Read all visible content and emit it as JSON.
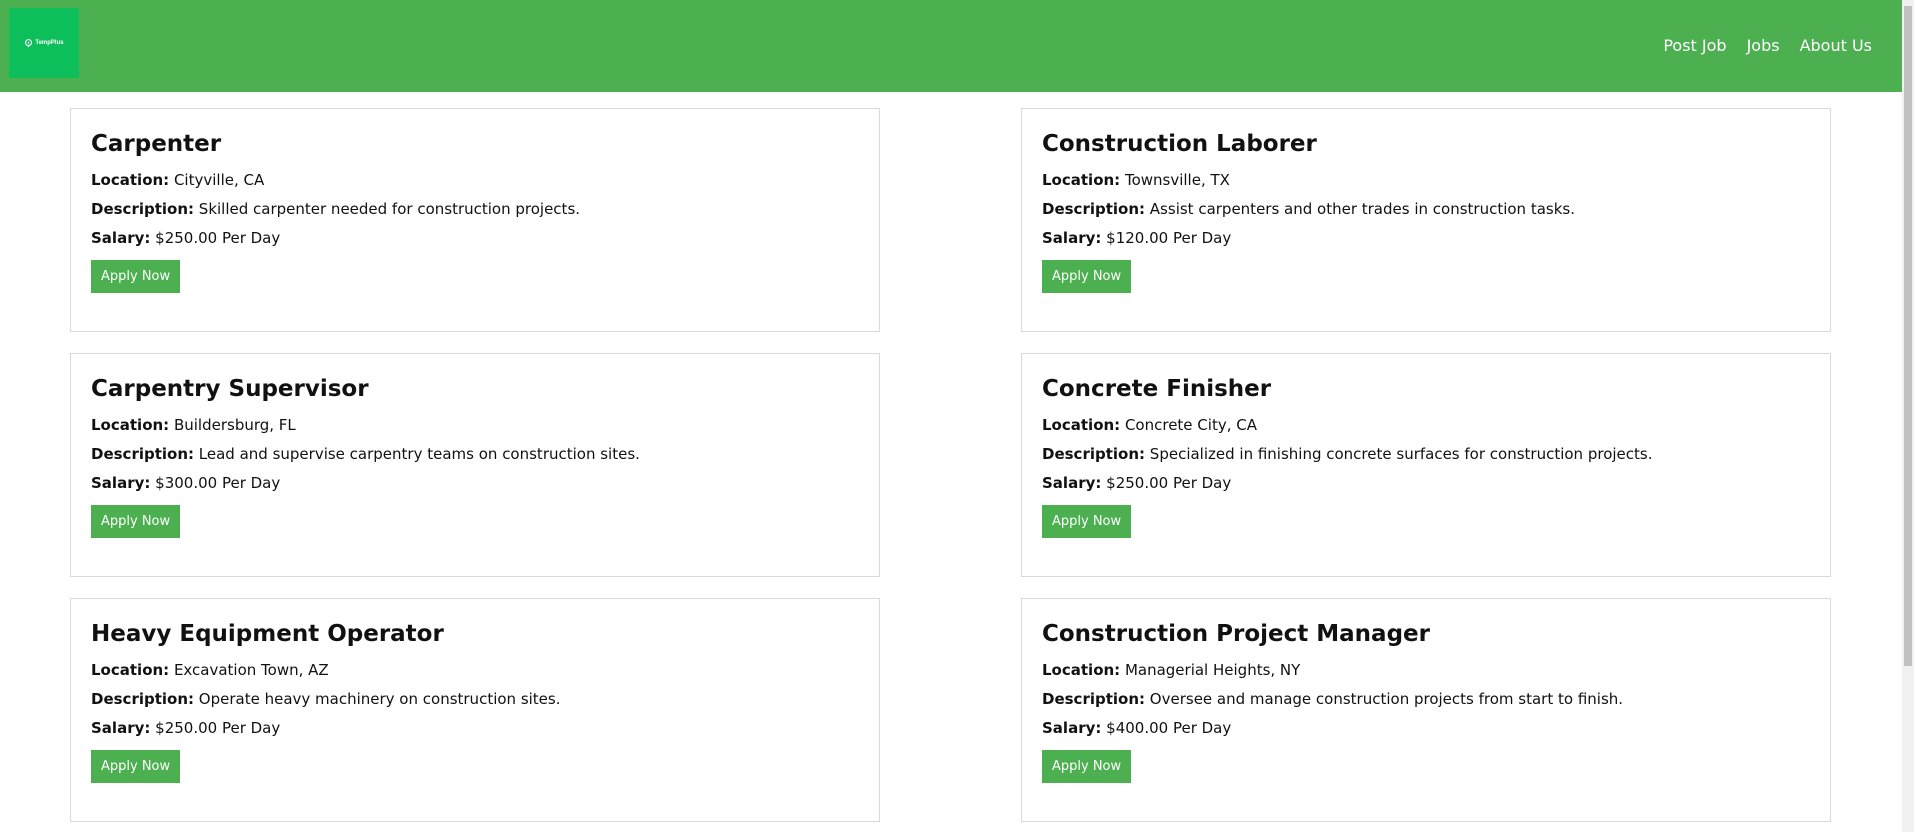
{
  "header": {
    "logo_text": "TempPlus",
    "bg_color": "#4caf50",
    "logo_color": "#0dbf5a",
    "nav": [
      "Post Job",
      "Jobs",
      "About Us"
    ]
  },
  "labels": {
    "location": "Location:",
    "description": "Description:",
    "salary": "Salary:",
    "apply": "Apply Now"
  },
  "jobs": [
    {
      "title": "Carpenter",
      "location": "Cityville, CA",
      "description": "Skilled carpenter needed for construction projects.",
      "salary": "$250.00 Per Day"
    },
    {
      "title": "Construction Laborer",
      "location": "Townsville, TX",
      "description": "Assist carpenters and other trades in construction tasks.",
      "salary": "$120.00 Per Day"
    },
    {
      "title": "Carpentry Supervisor",
      "location": "Buildersburg, FL",
      "description": "Lead and supervise carpentry teams on construction sites.",
      "salary": "$300.00 Per Day"
    },
    {
      "title": "Concrete Finisher",
      "location": "Concrete City, CA",
      "description": "Specialized in finishing concrete surfaces for construction projects.",
      "salary": "$250.00 Per Day"
    },
    {
      "title": "Heavy Equipment Operator",
      "location": "Excavation Town, AZ",
      "description": "Operate heavy machinery on construction sites.",
      "salary": "$250.00 Per Day"
    },
    {
      "title": "Construction Project Manager",
      "location": "Managerial Heights, NY",
      "description": "Oversee and manage construction projects from start to finish.",
      "salary": "$400.00 Per Day"
    }
  ]
}
